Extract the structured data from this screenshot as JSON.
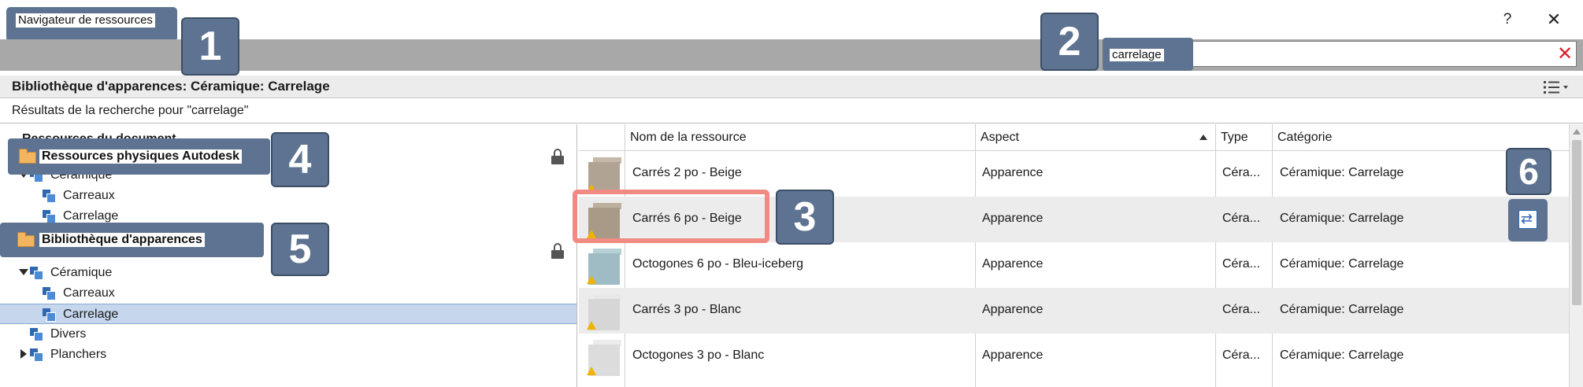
{
  "window": {
    "title": "Navigateur de ressources",
    "help_label": "?",
    "close_label": "✕"
  },
  "search": {
    "value": "carrelage",
    "clear_label": "✕"
  },
  "breadcrumb": "Bibliothèque d'apparences: Céramique: Carrelage",
  "results_text": "Résultats de la recherche pour \"carrelage\"",
  "tree": {
    "header": "Ressources du document",
    "groups": [
      {
        "label": "Ressources physiques Autodesk",
        "items": [
          {
            "label": "Céramique",
            "expanded": true
          },
          {
            "label": "Carreaux"
          },
          {
            "label": "Carrelage"
          }
        ]
      },
      {
        "label": "Bibliothèque d'apparences",
        "items": [
          {
            "label": "Céramique",
            "expanded": true
          },
          {
            "label": "Carreaux"
          },
          {
            "label": "Carrelage",
            "selected": true
          },
          {
            "label": "Divers"
          },
          {
            "label": "Planchers",
            "expanded": false
          }
        ]
      }
    ]
  },
  "grid": {
    "columns": [
      "Nom de la ressource",
      "Aspect",
      "Type",
      "Catégorie"
    ],
    "rows": [
      {
        "name": "Carrés 2 po - Beige",
        "aspect": "Apparence",
        "type": "Céra...",
        "category": "Céramique: Carrelage",
        "swatch": "#b0a393"
      },
      {
        "name": "Carrés 6 po - Beige",
        "aspect": "Apparence",
        "type": "Céra...",
        "category": "Céramique: Carrelage",
        "swatch": "#a89a86"
      },
      {
        "name": "Octogones 6 po - Bleu-iceberg",
        "aspect": "Apparence",
        "type": "Céra...",
        "category": "Céramique: Carrelage",
        "swatch": "#9fbcc4"
      },
      {
        "name": "Carrés 3 po - Blanc",
        "aspect": "Apparence",
        "type": "Céra...",
        "category": "Céramique: Carrelage",
        "swatch": "#d6d6d6"
      },
      {
        "name": "Octogones 3 po - Blanc",
        "aspect": "Apparence",
        "type": "Céra...",
        "category": "Céramique: Carrelage",
        "swatch": "#dcdcdc"
      }
    ]
  },
  "callouts": [
    "1",
    "2",
    "3",
    "4",
    "5",
    "6"
  ],
  "colors": {
    "callout": "#5e7391",
    "highlight": "#f08a83",
    "selection": "#c5d6ed"
  }
}
